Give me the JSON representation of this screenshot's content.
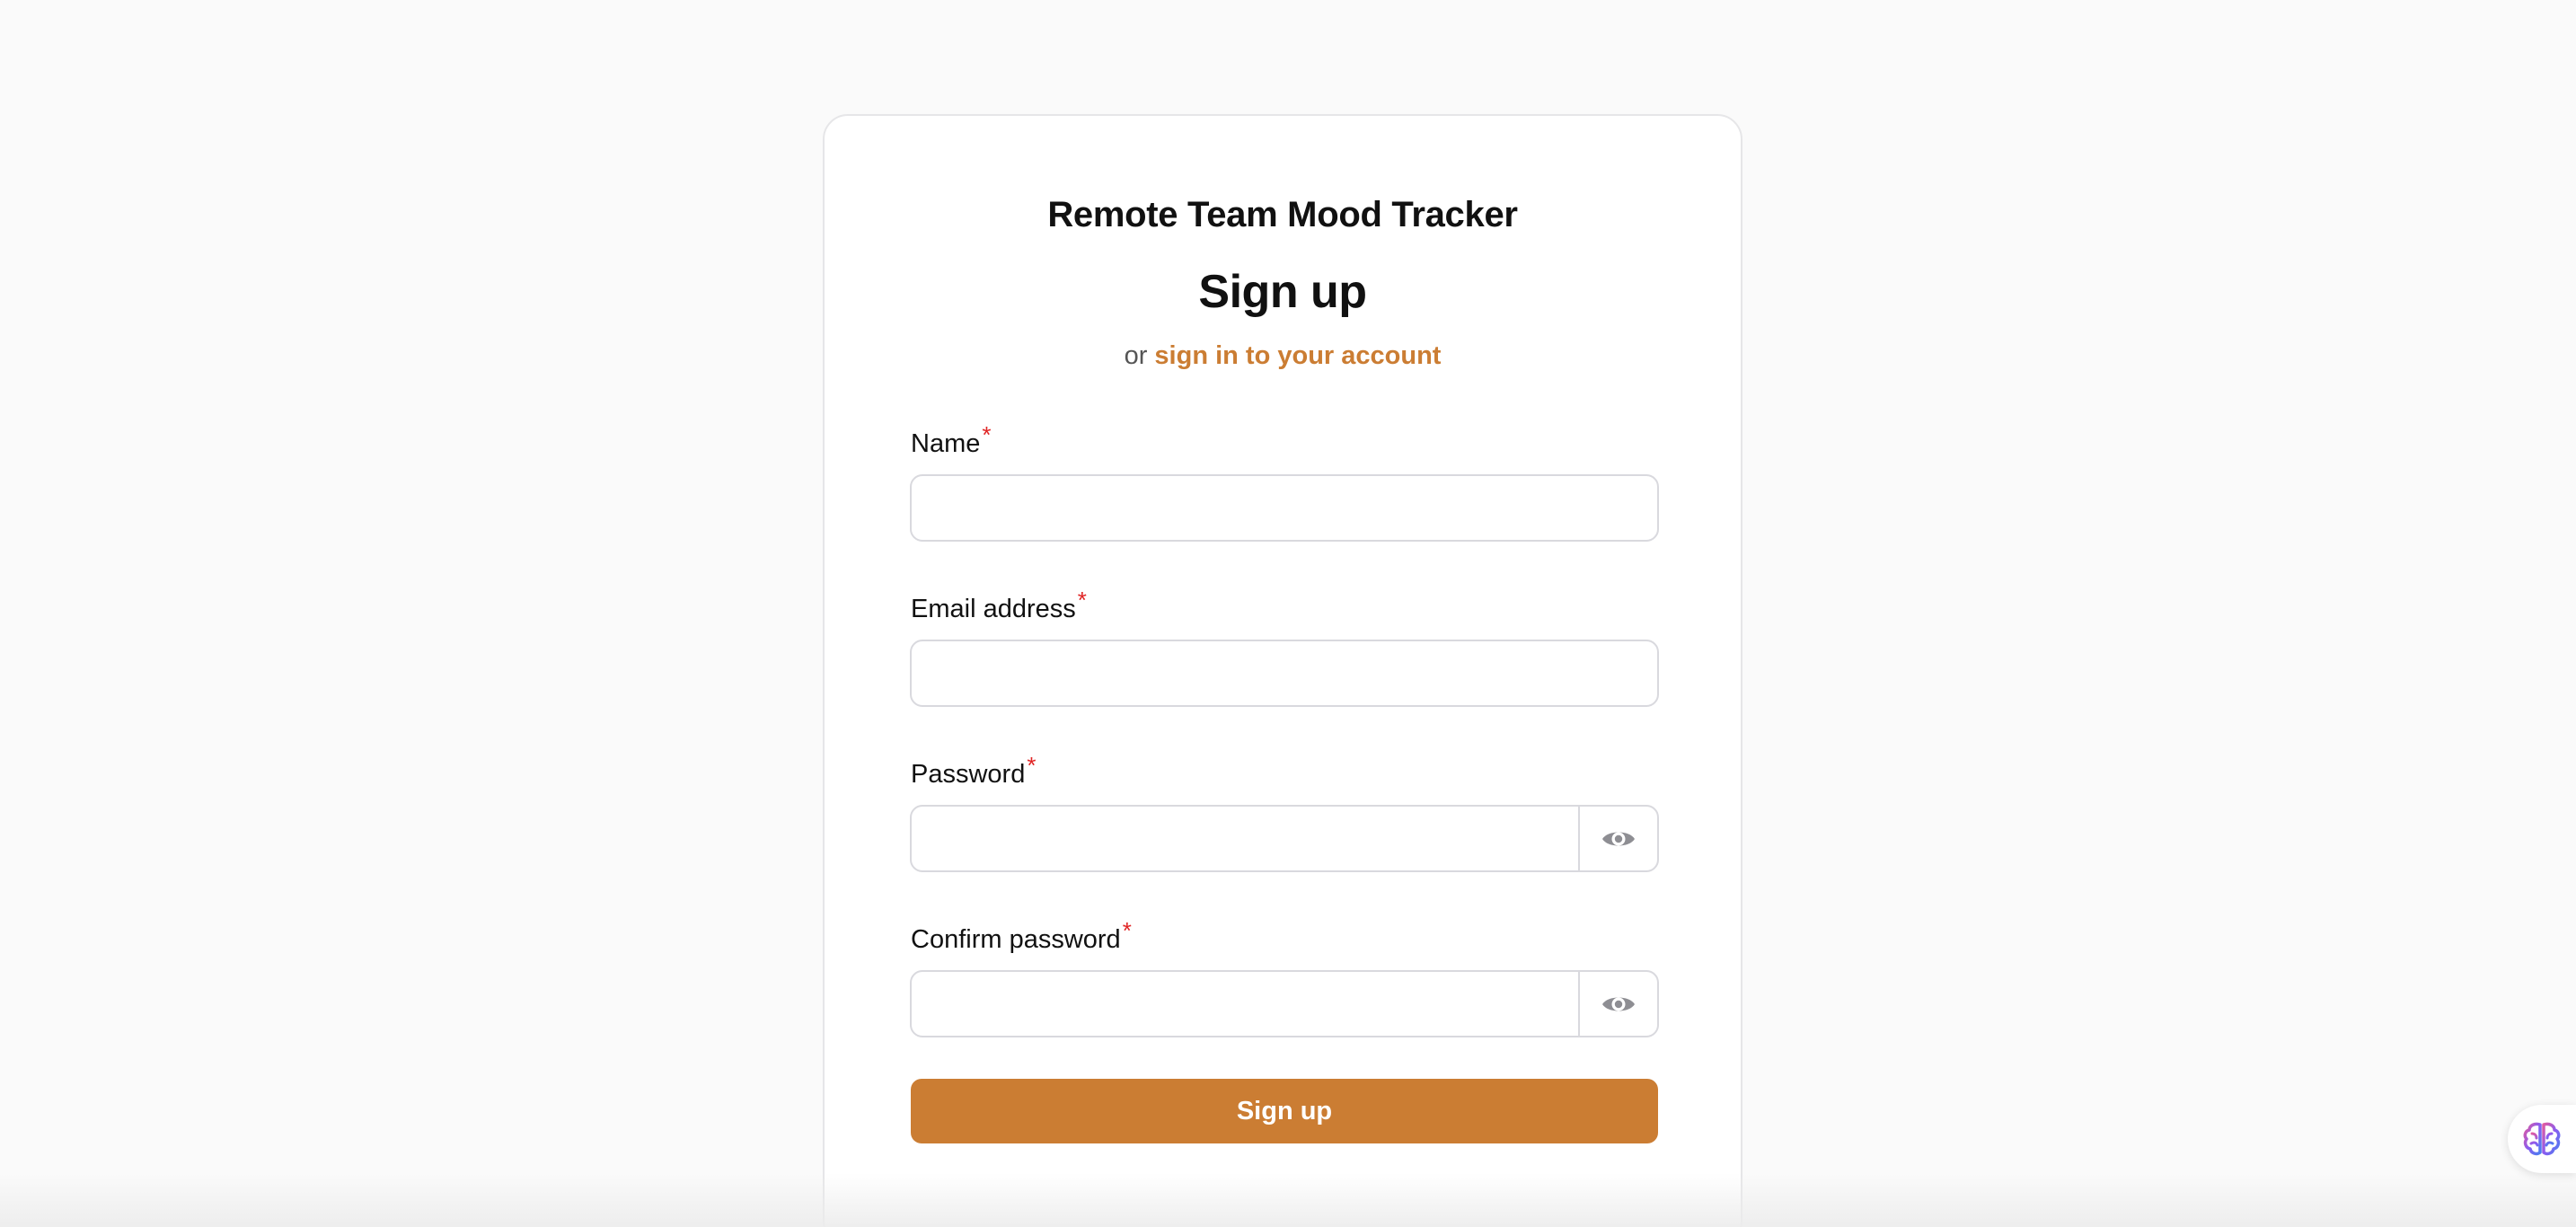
{
  "app": {
    "name": "Remote Team Mood Tracker"
  },
  "form": {
    "heading": "Sign up",
    "subline_prefix": "or",
    "signin_link": "sign in to your account",
    "required_mark": "*",
    "fields": {
      "name": {
        "label": "Name",
        "value": "",
        "placeholder": ""
      },
      "email": {
        "label": "Email address",
        "value": "",
        "placeholder": ""
      },
      "password": {
        "label": "Password",
        "value": "",
        "placeholder": ""
      },
      "confirm_password": {
        "label": "Confirm password",
        "value": "",
        "placeholder": ""
      }
    },
    "submit_label": "Sign up"
  },
  "icons": {
    "password_toggle": "eye-icon",
    "assistant": "brain-icon"
  },
  "colors": {
    "accent": "#cb7d33",
    "required": "#e02424",
    "background": "#fafafa",
    "card": "#ffffff"
  }
}
